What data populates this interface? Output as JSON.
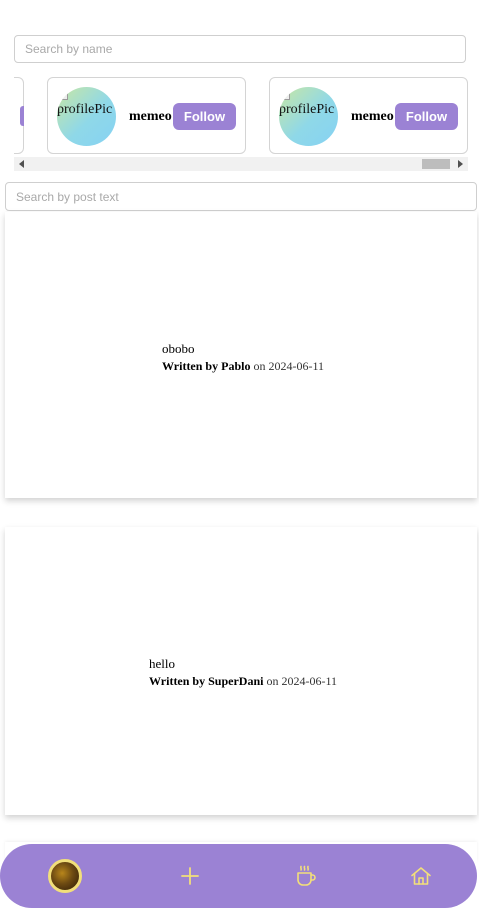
{
  "search": {
    "name_placeholder": "Search by name",
    "post_placeholder": "Search by post text"
  },
  "carousel": {
    "cards": [
      {
        "image_alt": "profilePic",
        "name": "memeo",
        "button_label": "Follow"
      },
      {
        "image_alt": "profilePic",
        "name": "memeo",
        "button_label": "Follow"
      }
    ]
  },
  "posts": [
    {
      "text": "obobo",
      "written_by_label": "Written by",
      "author": "Pablo",
      "on_label": "on",
      "date": "2024-06-11"
    },
    {
      "text": "hello",
      "written_by_label": "Written by",
      "author": "SuperDani",
      "on_label": "on",
      "date": "2024-06-11"
    }
  ],
  "nav": {
    "items": [
      "avatar",
      "plus-icon",
      "coffee-icon",
      "home-icon"
    ]
  },
  "colors": {
    "accent": "#9b82d4",
    "nav_icon": "#f2df7a",
    "card_border": "#d4d4d4"
  }
}
